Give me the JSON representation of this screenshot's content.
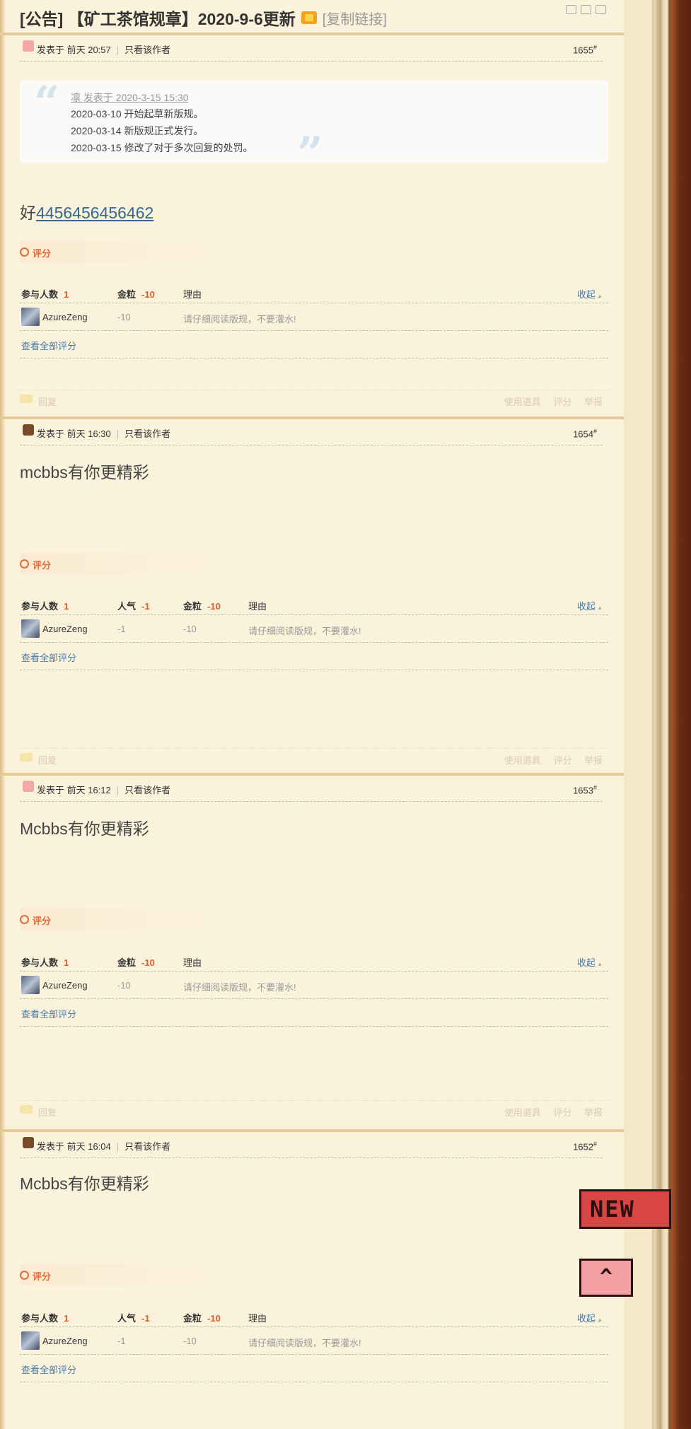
{
  "thread": {
    "title": "[公告] 【矿工茶馆规章】2020-9-6更新",
    "copy_link": "[复制链接]"
  },
  "posts": [
    {
      "avatar": "pig",
      "posted": "发表于 前天 20:57",
      "only_author": "只看该作者",
      "floor": "1655",
      "quote": {
        "author": "凛 发表于 2020-3-15 15:30",
        "lines": [
          "2020-03-10 开始起草新版规。",
          "2020-03-14 新版规正式发行。",
          "2020-03-15 修改了对于多次回复的处罚。"
        ]
      },
      "content_prefix": "好",
      "content_link": "4456456456462",
      "rating": {
        "label": "评分",
        "participants_label": "参与人数",
        "participants": "1",
        "col1_label": "金粒",
        "col1_total": "-10",
        "reason_label": "理由",
        "collapse": "收起",
        "user": "AzureZeng",
        "col1_value": "-10",
        "reason": "请仔细阅读版规，不要灌水!",
        "view_all": "查看全部评分"
      },
      "footer": {
        "reply": "回复",
        "tools": "使用道具",
        "rate": "评分",
        "report": "举报"
      }
    },
    {
      "avatar": "steve",
      "posted": "发表于 前天 16:30",
      "only_author": "只看该作者",
      "floor": "1654",
      "content": "mcbbs有你更精彩",
      "rating": {
        "label": "评分",
        "participants_label": "参与人数",
        "participants": "1",
        "col1_label": "人气",
        "col1_total": "-1",
        "col2_label": "金粒",
        "col2_total": "-10",
        "reason_label": "理由",
        "collapse": "收起",
        "user": "AzureZeng",
        "col1_value": "-1",
        "col2_value": "-10",
        "reason": "请仔细阅读版规，不要灌水!",
        "view_all": "查看全部评分"
      },
      "footer": {
        "reply": "回复",
        "tools": "使用道具",
        "rate": "评分",
        "report": "举报"
      }
    },
    {
      "avatar": "pig",
      "posted": "发表于 前天 16:12",
      "only_author": "只看该作者",
      "floor": "1653",
      "content": "Mcbbs有你更精彩",
      "rating": {
        "label": "评分",
        "participants_label": "参与人数",
        "participants": "1",
        "col1_label": "金粒",
        "col1_total": "-10",
        "reason_label": "理由",
        "collapse": "收起",
        "user": "AzureZeng",
        "col1_value": "-10",
        "reason": "请仔细阅读版规，不要灌水!",
        "view_all": "查看全部评分"
      },
      "footer": {
        "reply": "回复",
        "tools": "使用道具",
        "rate": "评分",
        "report": "举报"
      }
    },
    {
      "avatar": "steve",
      "posted": "发表于 前天 16:04",
      "only_author": "只看该作者",
      "floor": "1652",
      "content": "Mcbbs有你更精彩",
      "rating": {
        "label": "评分",
        "participants_label": "参与人数",
        "participants": "1",
        "col1_label": "人气",
        "col1_total": "-1",
        "col2_label": "金粒",
        "col2_total": "-10",
        "reason_label": "理由",
        "collapse": "收起",
        "user": "AzureZeng",
        "col1_value": "-1",
        "col2_value": "-10",
        "reason": "请仔细阅读版规，不要灌水!",
        "view_all": "查看全部评分"
      }
    }
  ],
  "badges": {
    "news": "NEW",
    "flag": "^"
  }
}
